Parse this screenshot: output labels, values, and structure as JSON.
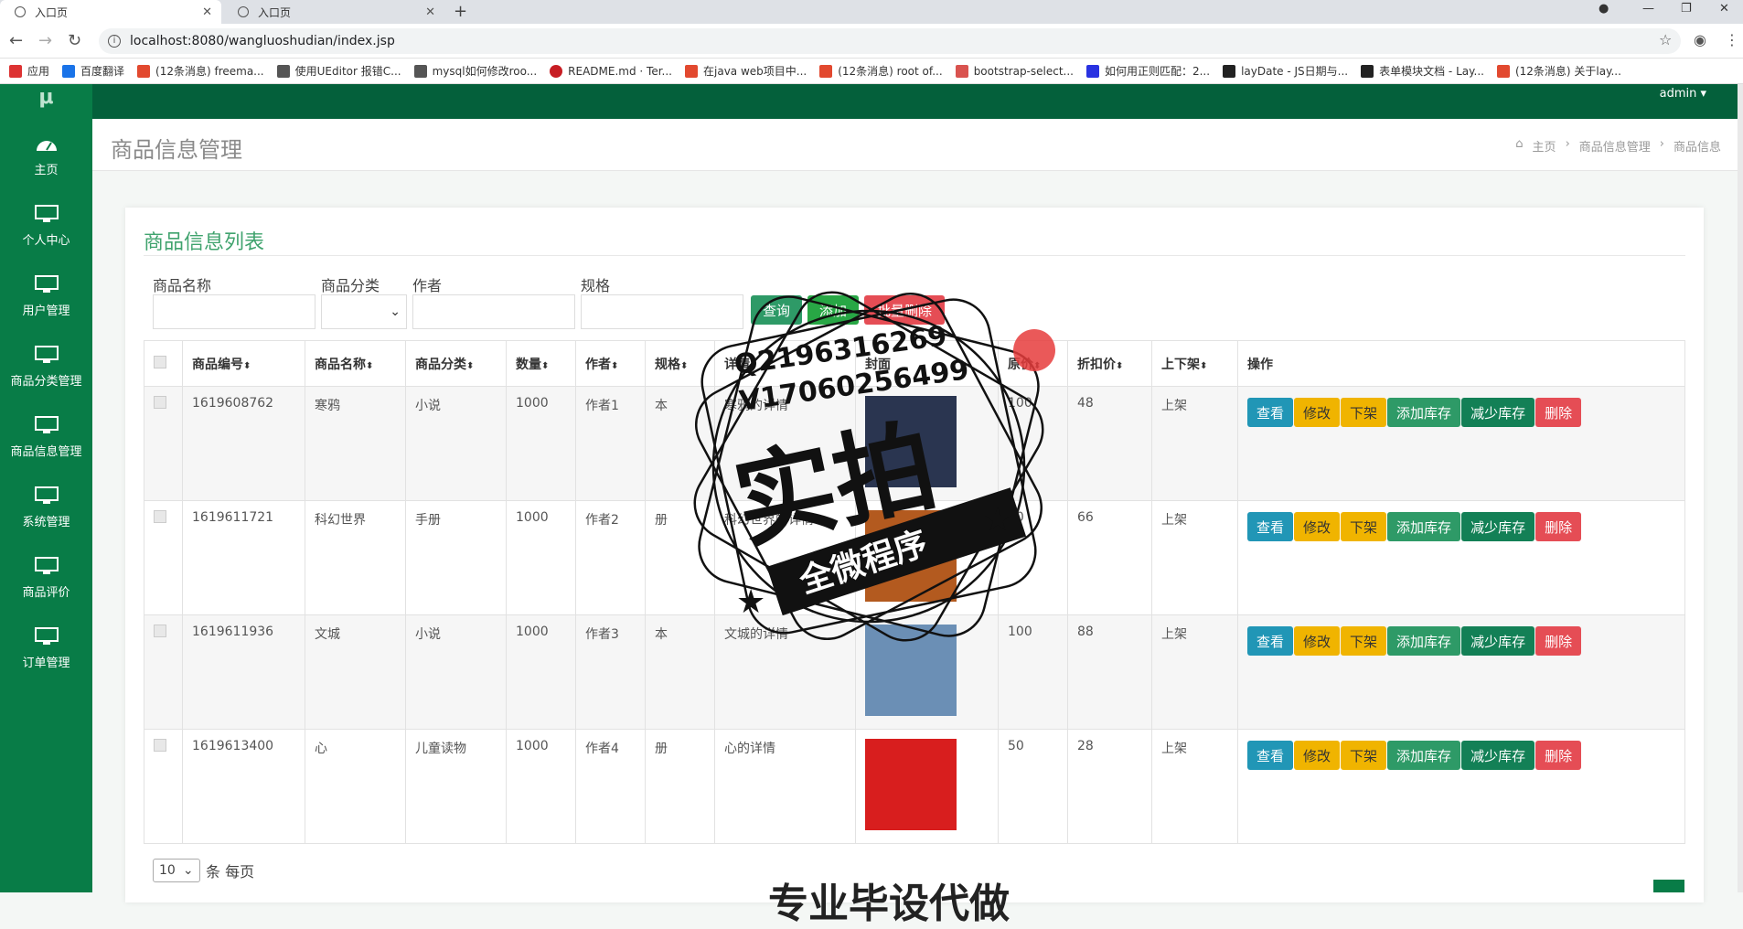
{
  "browser": {
    "tabs": [
      {
        "label": "入口页"
      },
      {
        "label": "入口页"
      }
    ],
    "url": "localhost:8080/wangluoshudian/index.jsp",
    "bookmarks": [
      "应用",
      "百度翻译",
      "(12条消息) freema...",
      "使用UEditor 报错C...",
      "mysql如何修改roo...",
      "README.md · Ter...",
      "在java web项目中...",
      "(12条消息) root of...",
      "bootstrap-select...",
      "如何用正则匹配：2...",
      "layDate - JS日期与...",
      "表单模块文档 - Lay...",
      "(12条消息) 关于lay..."
    ]
  },
  "app": {
    "logo": "μ",
    "admin": "admin ▾",
    "menu": [
      "主页",
      "个人中心",
      "用户管理",
      "商品分类管理",
      "商品信息管理",
      "系统管理",
      "商品评价",
      "订单管理"
    ],
    "page_title": "商品信息管理",
    "breadcrumb": [
      "主页",
      "商品信息管理",
      "商品信息"
    ],
    "card_title": "商品信息列表",
    "filters": {
      "name": "商品名称",
      "category": "商品分类",
      "author": "作者",
      "spec": "规格"
    },
    "buttons": {
      "search": "查询",
      "add": "添加",
      "batch_delete": "批量删除"
    },
    "columns": [
      "商品编号",
      "商品名称",
      "商品分类",
      "数量",
      "作者",
      "规格",
      "详情",
      "封面",
      "原价",
      "折扣价",
      "上下架",
      "操作"
    ],
    "rows": [
      {
        "id": "1619608762",
        "name": "寒鸦",
        "category": "小说",
        "qty": "1000",
        "author": "作者1",
        "spec": "本",
        "detail": "寒鸦的详情",
        "price": "100",
        "discount": "48",
        "status": "上架",
        "cover_color": "#2a3550"
      },
      {
        "id": "1619611721",
        "name": "科幻世界",
        "category": "手册",
        "qty": "1000",
        "author": "作者2",
        "spec": "册",
        "detail": "科幻世界的详情",
        "price": "80",
        "discount": "66",
        "status": "上架",
        "cover_color": "#b35a1f"
      },
      {
        "id": "1619611936",
        "name": "文城",
        "category": "小说",
        "qty": "1000",
        "author": "作者3",
        "spec": "本",
        "detail": "文城的详情",
        "price": "100",
        "discount": "88",
        "status": "上架",
        "cover_color": "#6b8fb5"
      },
      {
        "id": "1619613400",
        "name": "心",
        "category": "儿童读物",
        "qty": "1000",
        "author": "作者4",
        "spec": "册",
        "detail": "心的详情",
        "price": "50",
        "discount": "28",
        "status": "上架",
        "cover_color": "#d81e1e"
      }
    ],
    "ops": [
      "查看",
      "修改",
      "下架",
      "添加库存",
      "减少库存",
      "删除"
    ],
    "pager": {
      "size": "10",
      "suffix": "条 每页"
    }
  },
  "watermark": {
    "line1": "Q2196316269",
    "line2": "V17060256499",
    "big": "实拍",
    "banner": "全微程序",
    "bottom": "专业毕设代做"
  }
}
